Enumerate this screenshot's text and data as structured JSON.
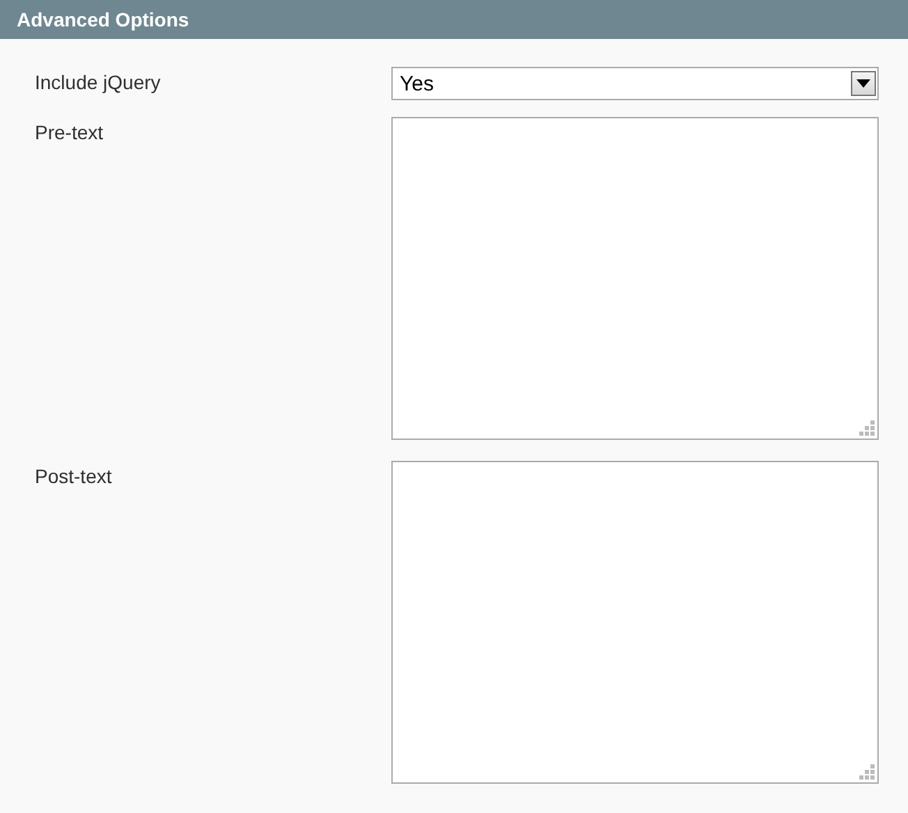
{
  "section": {
    "title": "Advanced Options"
  },
  "fields": [
    {
      "kind": "select",
      "label": "Include jQuery",
      "value": "Yes"
    },
    {
      "kind": "textarea",
      "label": "Pre-text"
    },
    {
      "kind": "textarea",
      "label": "Post-text"
    }
  ]
}
